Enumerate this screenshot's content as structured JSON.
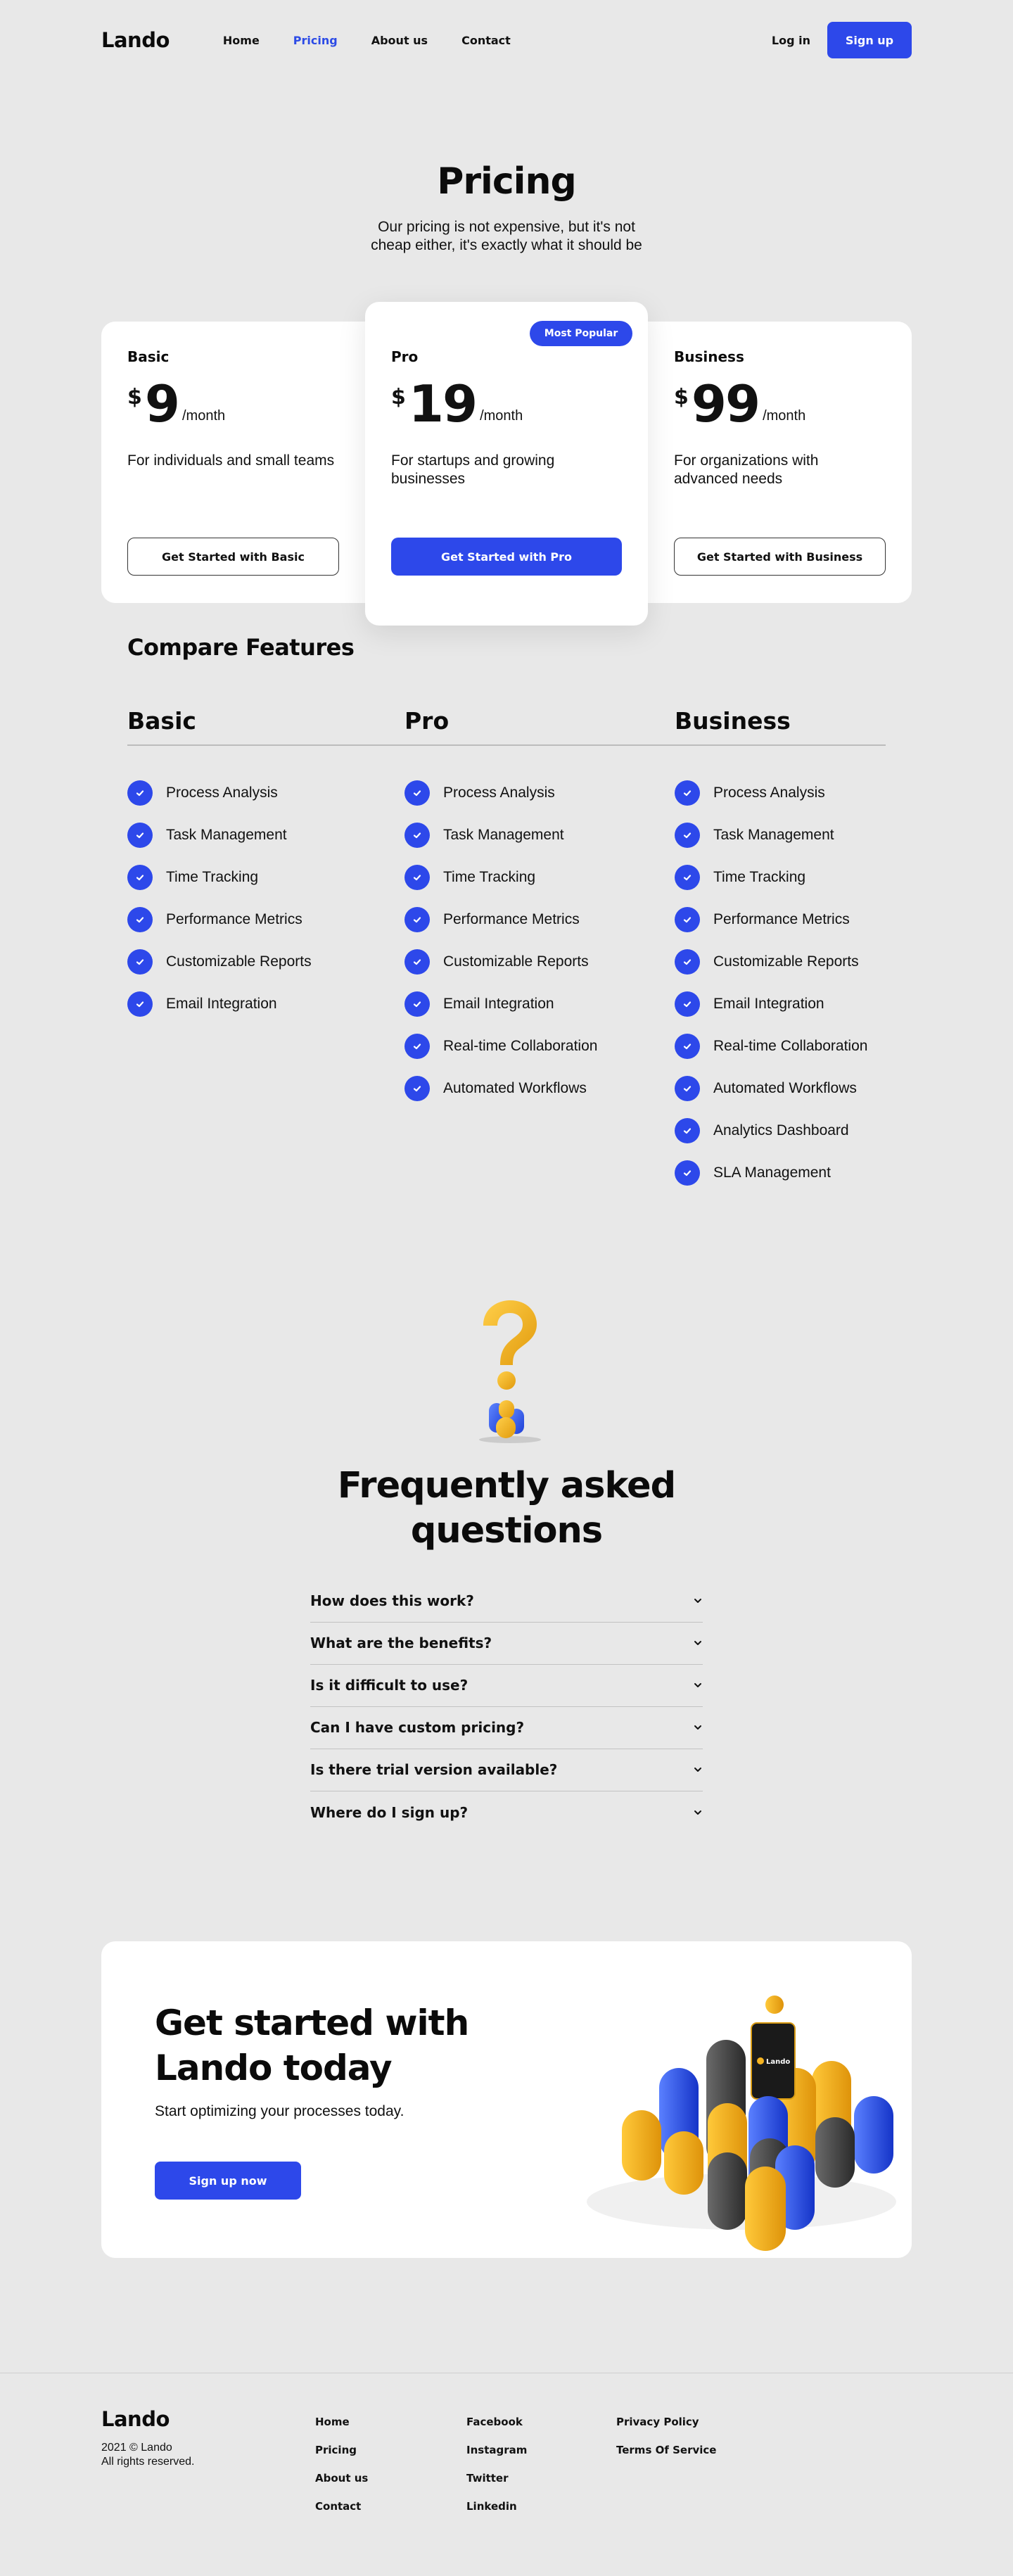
{
  "nav": {
    "logo": "Lando",
    "links": [
      "Home",
      "Pricing",
      "About us",
      "Contact"
    ],
    "active": "Pricing",
    "login": "Log in",
    "signup": "Sign up"
  },
  "hero": {
    "title": "Pricing",
    "subtitle": "Our pricing is not expensive, but it's not cheap either, it's exactly what it should be"
  },
  "plans": [
    {
      "name": "Basic",
      "currency": "$",
      "price": "9",
      "period": "/month",
      "description": "For individuals and small teams",
      "cta": "Get Started with Basic"
    },
    {
      "name": "Pro",
      "currency": "$",
      "price": "19",
      "period": "/month",
      "description": "For startups and growing businesses",
      "cta": "Get Started with Pro",
      "badge": "Most Popular"
    },
    {
      "name": "Business",
      "currency": "$",
      "price": "99",
      "period": "/month",
      "description": "For organizations with advanced needs",
      "cta": "Get Started with Business"
    }
  ],
  "compare": {
    "title": "Compare Features",
    "columns": [
      {
        "name": "Basic",
        "features": [
          "Process Analysis",
          "Task Management",
          "Time Tracking",
          "Performance Metrics",
          "Customizable Reports",
          "Email Integration"
        ]
      },
      {
        "name": "Pro",
        "features": [
          "Process Analysis",
          "Task Management",
          "Time Tracking",
          "Performance Metrics",
          "Customizable Reports",
          "Email Integration",
          "Real-time Collaboration",
          "Automated Workflows"
        ]
      },
      {
        "name": "Business",
        "features": [
          "Process Analysis",
          "Task Management",
          "Time Tracking",
          "Performance Metrics",
          "Customizable Reports",
          "Email Integration",
          "Real-time Collaboration",
          "Automated Workflows",
          "Analytics Dashboard",
          "SLA Management"
        ]
      }
    ]
  },
  "faq": {
    "title": "Frequently asked questions",
    "questions": [
      "How does this work?",
      "What are the benefits?",
      "Is it difficult to use?",
      "Can I have custom pricing?",
      "Is there trial version available?",
      "Where do I sign up?"
    ]
  },
  "cta": {
    "title": "Get started with Lando today",
    "subtitle": "Start optimizing your processes today.",
    "button": "Sign up now",
    "phone_brand": "Lando"
  },
  "footer": {
    "logo": "Lando",
    "copyright_line1": "2021 © Lando",
    "copyright_line2": "All rights reserved.",
    "col1": [
      "Home",
      "Pricing",
      "About us",
      "Contact"
    ],
    "col2": [
      "Facebook",
      "Instagram",
      "Twitter",
      "Linkedin"
    ],
    "col3": [
      "Privacy Policy",
      "Terms Of Service"
    ]
  },
  "colors": {
    "accent": "#2d48ea",
    "background": "#e8e8e8",
    "card": "#ffffff",
    "yellow": "#f2b01e",
    "dark": "#3c3c3c"
  }
}
